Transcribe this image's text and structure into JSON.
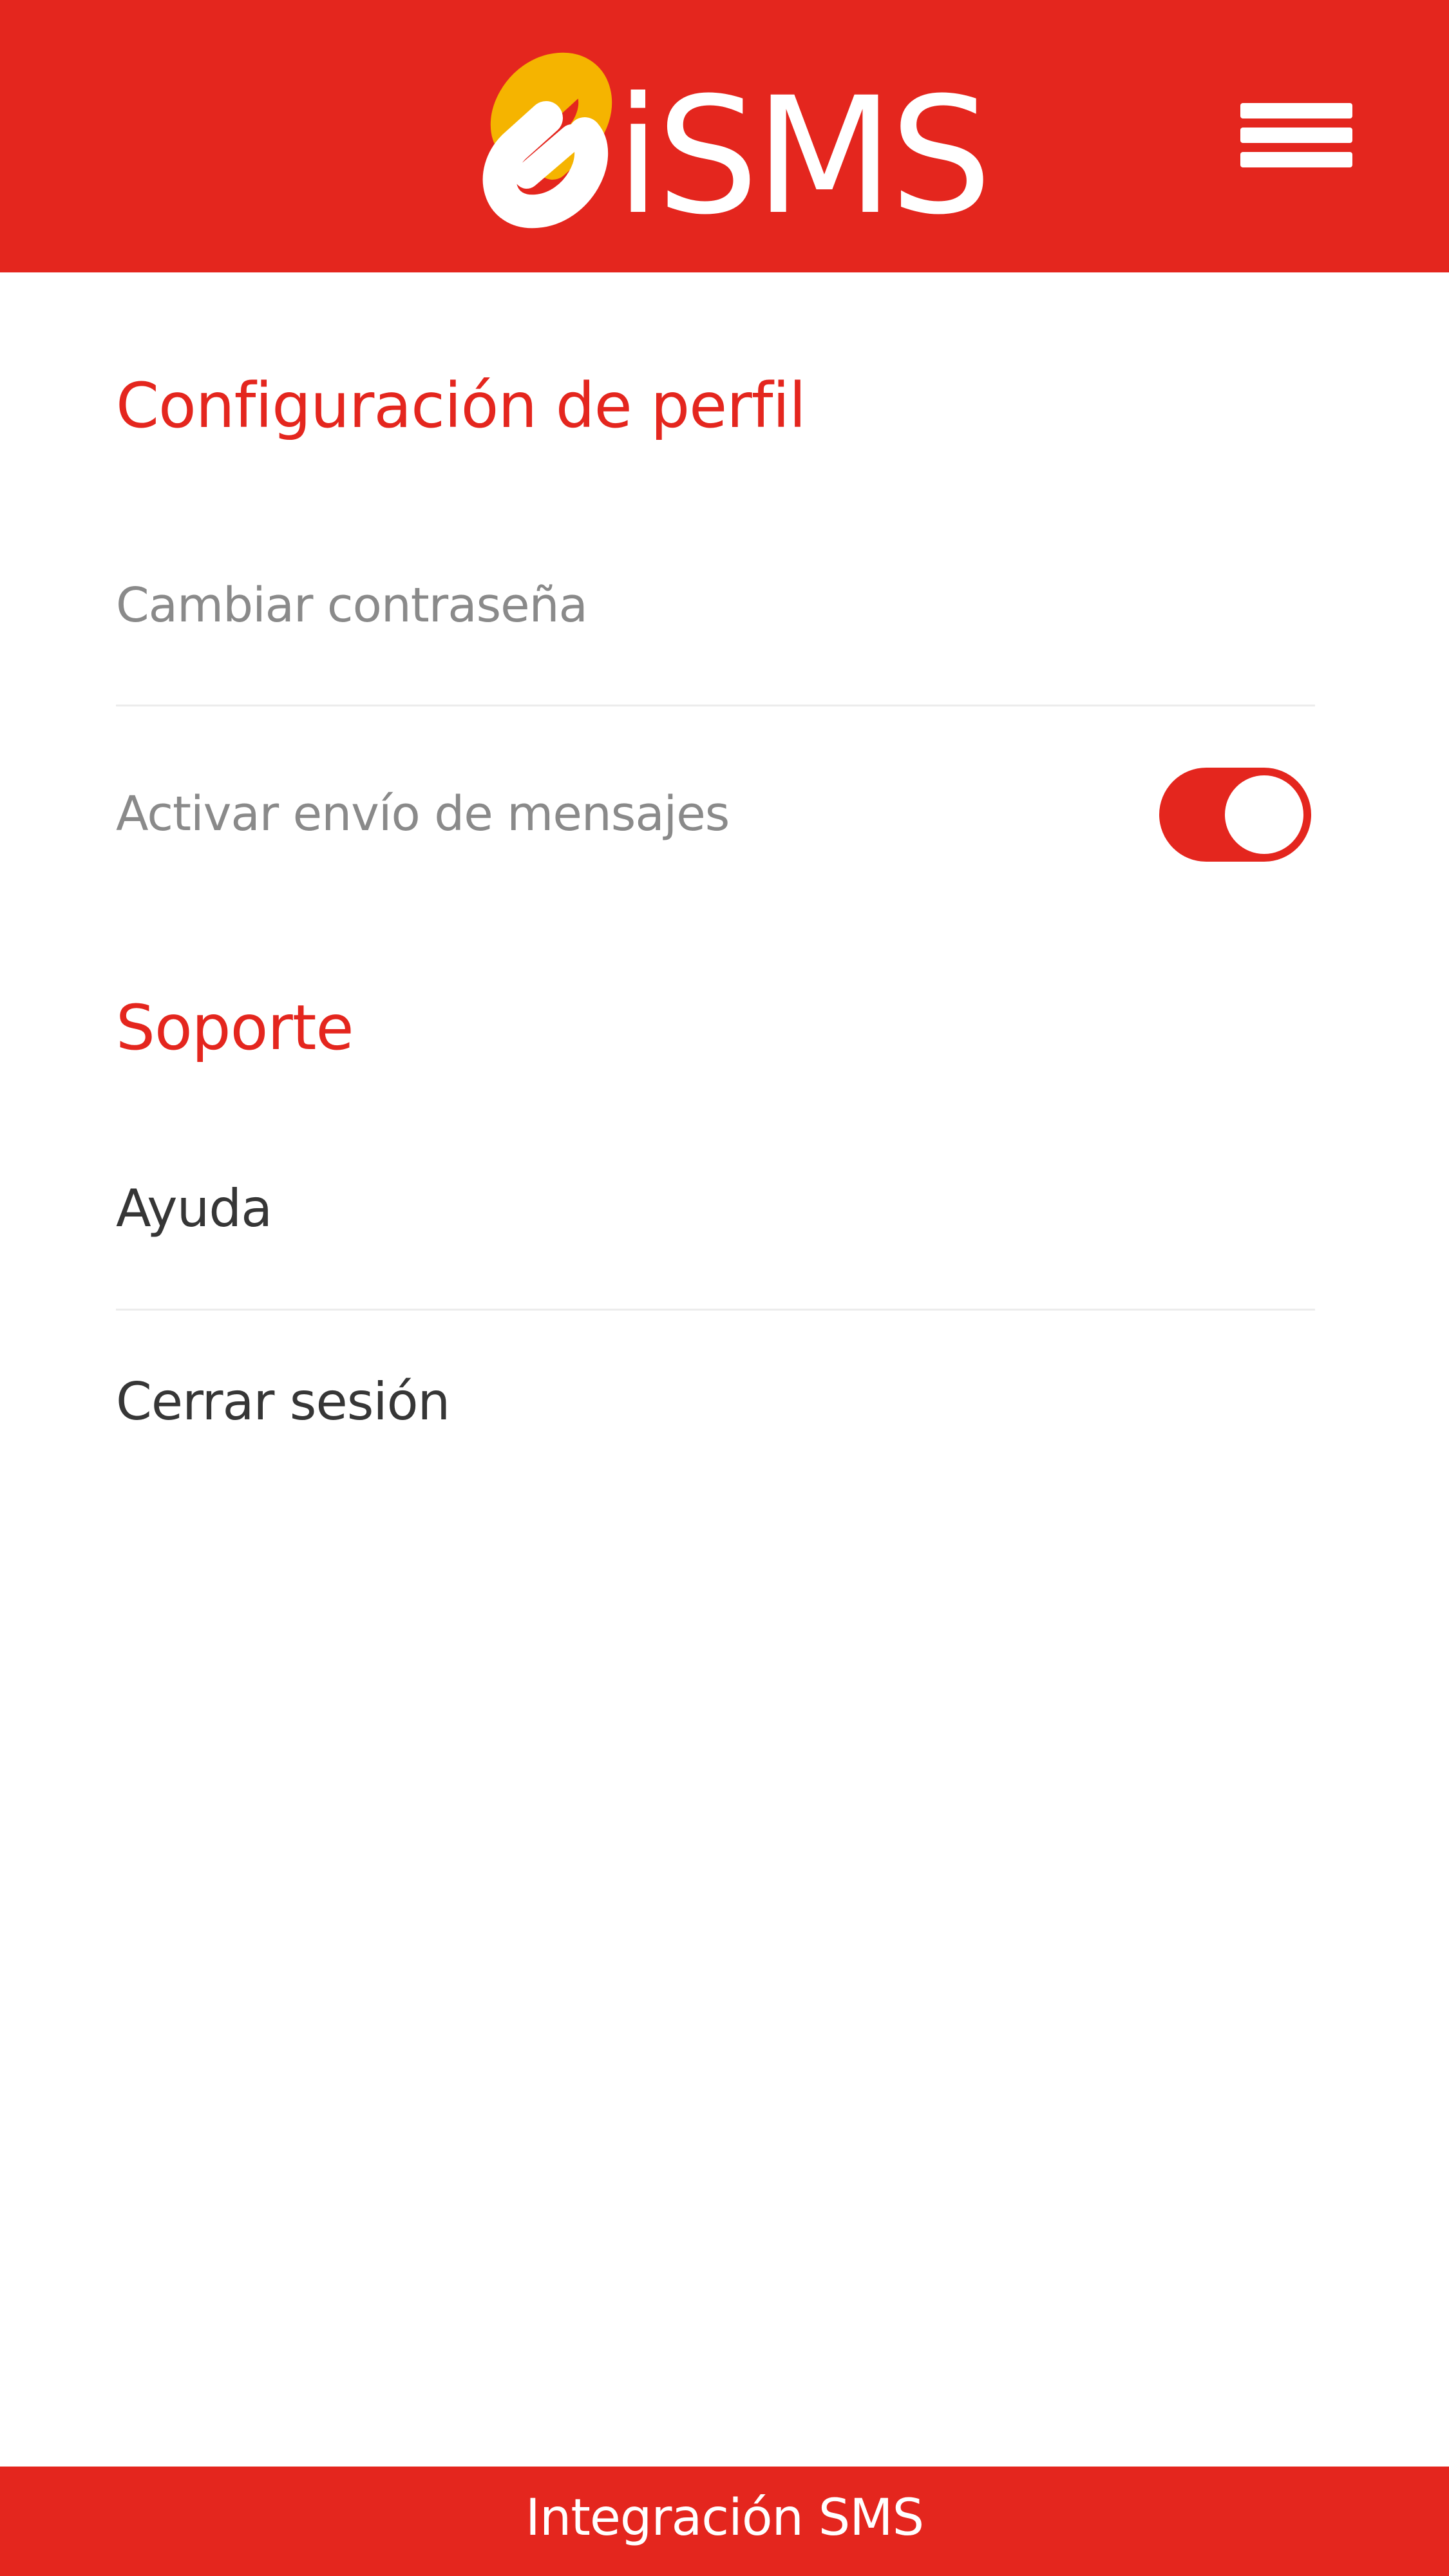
{
  "app": {
    "brand_name": "iSMS",
    "brand_color": "#e4261e",
    "accent_color": "#f5b400",
    "logo_icon": "chain-link-icon",
    "menu_icon": "hamburger-menu-icon"
  },
  "profile_section": {
    "title": "Configuración de perfil",
    "items": [
      {
        "label": "Cambiar contraseña"
      },
      {
        "label": "Activar envío de mensajes",
        "toggle_on": true
      }
    ]
  },
  "support_section": {
    "title": "Soporte",
    "items": [
      {
        "label": "Ayuda"
      },
      {
        "label": "Cerrar sesión"
      }
    ]
  },
  "footer": {
    "text": "Integración SMS"
  }
}
